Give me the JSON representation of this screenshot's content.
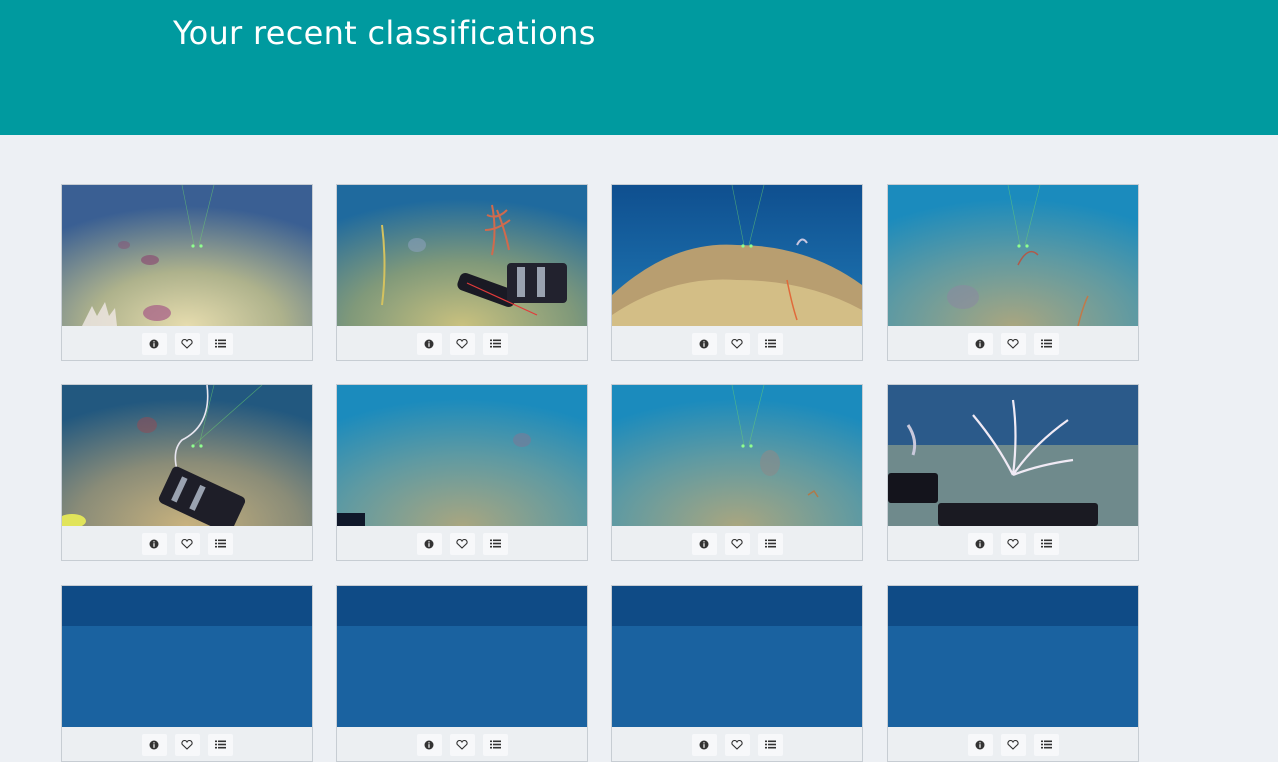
{
  "header": {
    "title": "Your recent classifications",
    "background": "#009a9f"
  },
  "classifications": [
    {
      "scene": "seafloor-lasers-pink-sponges"
    },
    {
      "scene": "seafloor-robot-arm-red-fan"
    },
    {
      "scene": "seafloor-lasers-reef"
    },
    {
      "scene": "seafloor-lasers-fan"
    },
    {
      "scene": "seafloor-robot-arm-cable"
    },
    {
      "scene": "seafloor-open-sand"
    },
    {
      "scene": "seafloor-lasers-rock"
    },
    {
      "scene": "seafloor-white-coral-robot"
    },
    {
      "scene": "seafloor-partial"
    },
    {
      "scene": "seafloor-partial"
    },
    {
      "scene": "seafloor-partial"
    },
    {
      "scene": "seafloor-partial"
    }
  ],
  "card_actions": [
    {
      "name": "info-button",
      "icon": "info-icon"
    },
    {
      "name": "favorite-button",
      "icon": "heart-icon"
    },
    {
      "name": "collections-button",
      "icon": "list-icon"
    }
  ]
}
